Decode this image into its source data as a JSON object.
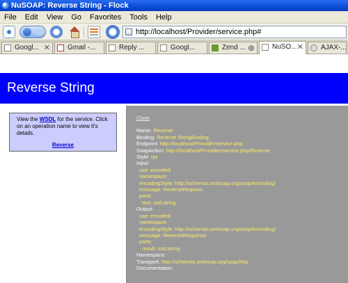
{
  "window": {
    "title": "NuSOAP: Reverse String - Flock"
  },
  "menu": [
    "File",
    "Edit",
    "View",
    "Go",
    "Favorites",
    "Tools",
    "Help"
  ],
  "address": {
    "url": "http://localhost/Provider/service.php#"
  },
  "tabs": [
    {
      "label": "Googl..."
    },
    {
      "label": "Gmail -..."
    },
    {
      "label": "Reply ..."
    },
    {
      "label": "Googl..."
    },
    {
      "label": "Zend ..."
    },
    {
      "label": "NuSO..."
    },
    {
      "label": "AJAX-..."
    }
  ],
  "page": {
    "title": "Reverse String",
    "sidebar": {
      "text_before": "View the ",
      "wsdl_link": "WSDL",
      "text_after": " for the service. Click on an operation name to view it's details.",
      "operation": "Reverse"
    },
    "detail": {
      "close": "Close",
      "name_label": "Name:",
      "name": "Reverse",
      "binding_label": "Binding:",
      "binding": "Reverse StringBinding",
      "endpoint_label": "Endpoint:",
      "endpoint": "http://localhost/Provider/service.php",
      "soapaction_label": "SoapAction:",
      "soapaction": "http://localhost/Provider/service.php/Reverse",
      "style_label": "Style:",
      "style": "rpc",
      "input_label": "Input:",
      "input_use_label": "use:",
      "input_use": "encoded",
      "input_ns_label": "namespace:",
      "input_ns": "",
      "input_enc_label": "encodingStyle:",
      "input_enc": "http://schemas.xmlsoap.org/soap/encoding/",
      "input_msg_label": "message:",
      "input_msg": "ReverseRequest",
      "input_parts_label": "parts:",
      "input_part_label": "text:",
      "input_part": "xsd:string",
      "output_label": "Output:",
      "output_use_label": "use:",
      "output_use": "encoded",
      "output_ns_label": "namespace:",
      "output_ns": "",
      "output_enc_label": "encodingStyle:",
      "output_enc": "http://schemas.xmlsoap.org/soap/encoding/",
      "output_msg_label": "message:",
      "output_msg": "ReverseResponse",
      "output_parts_label": "parts:",
      "output_part_label": "result:",
      "output_part": "xsd:string",
      "namespace_label": "Namespace:",
      "namespace": "",
      "transport_label": "Transport:",
      "transport": "http://schemas.xmlsoap.org/soap/http",
      "documentation_label": "Documentation:",
      "documentation": ""
    }
  },
  "colors": {
    "banner": "#0000ff",
    "sidebar_bg": "#ccccff",
    "detail_bg": "#999999",
    "detail_value": "#ffee66"
  }
}
